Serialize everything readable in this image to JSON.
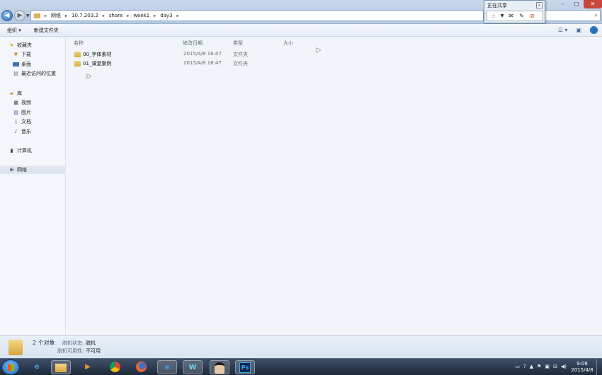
{
  "address": {
    "crumbs": [
      "网络",
      "10.7.203.2",
      "share",
      "week1",
      "day3"
    ]
  },
  "sharing_popup": {
    "title": "正在共享"
  },
  "toolbar": {
    "organize": "组织 ▾",
    "new_folder": "新建文件夹"
  },
  "nav": {
    "favorites": "收藏夹",
    "downloads": "下载",
    "desktop": "桌面",
    "recent": "最近访问的位置",
    "libraries": "库",
    "videos": "视频",
    "pictures": "图片",
    "documents": "文档",
    "music": "音乐",
    "computer": "计算机",
    "network": "网络"
  },
  "columns": {
    "name": "名称",
    "date": "修改日期",
    "type": "类型",
    "size": "大小"
  },
  "files": [
    {
      "name": "00_字体素材",
      "date": "2015/4/8 16:47",
      "type": "文件夹"
    },
    {
      "name": "01_课堂案例",
      "date": "2015/4/8 16:47",
      "type": "文件夹"
    }
  ],
  "details": {
    "count": "2 个对象",
    "offline_status_label": "脱机状态:",
    "offline_status_value": "脱机",
    "offline_avail_label": "脱机可用性:",
    "offline_avail_value": "不可用"
  },
  "taskbar": {
    "apps": [
      "ie-icon",
      "explorer-icon",
      "media-player-icon",
      "chrome-icon",
      "firefox-icon",
      "ie-window-icon",
      "app-w-icon",
      "avatar-app-icon",
      "photoshop-icon"
    ],
    "ps_label": "Ps",
    "time": "9:06",
    "date": "2015/4/8"
  }
}
